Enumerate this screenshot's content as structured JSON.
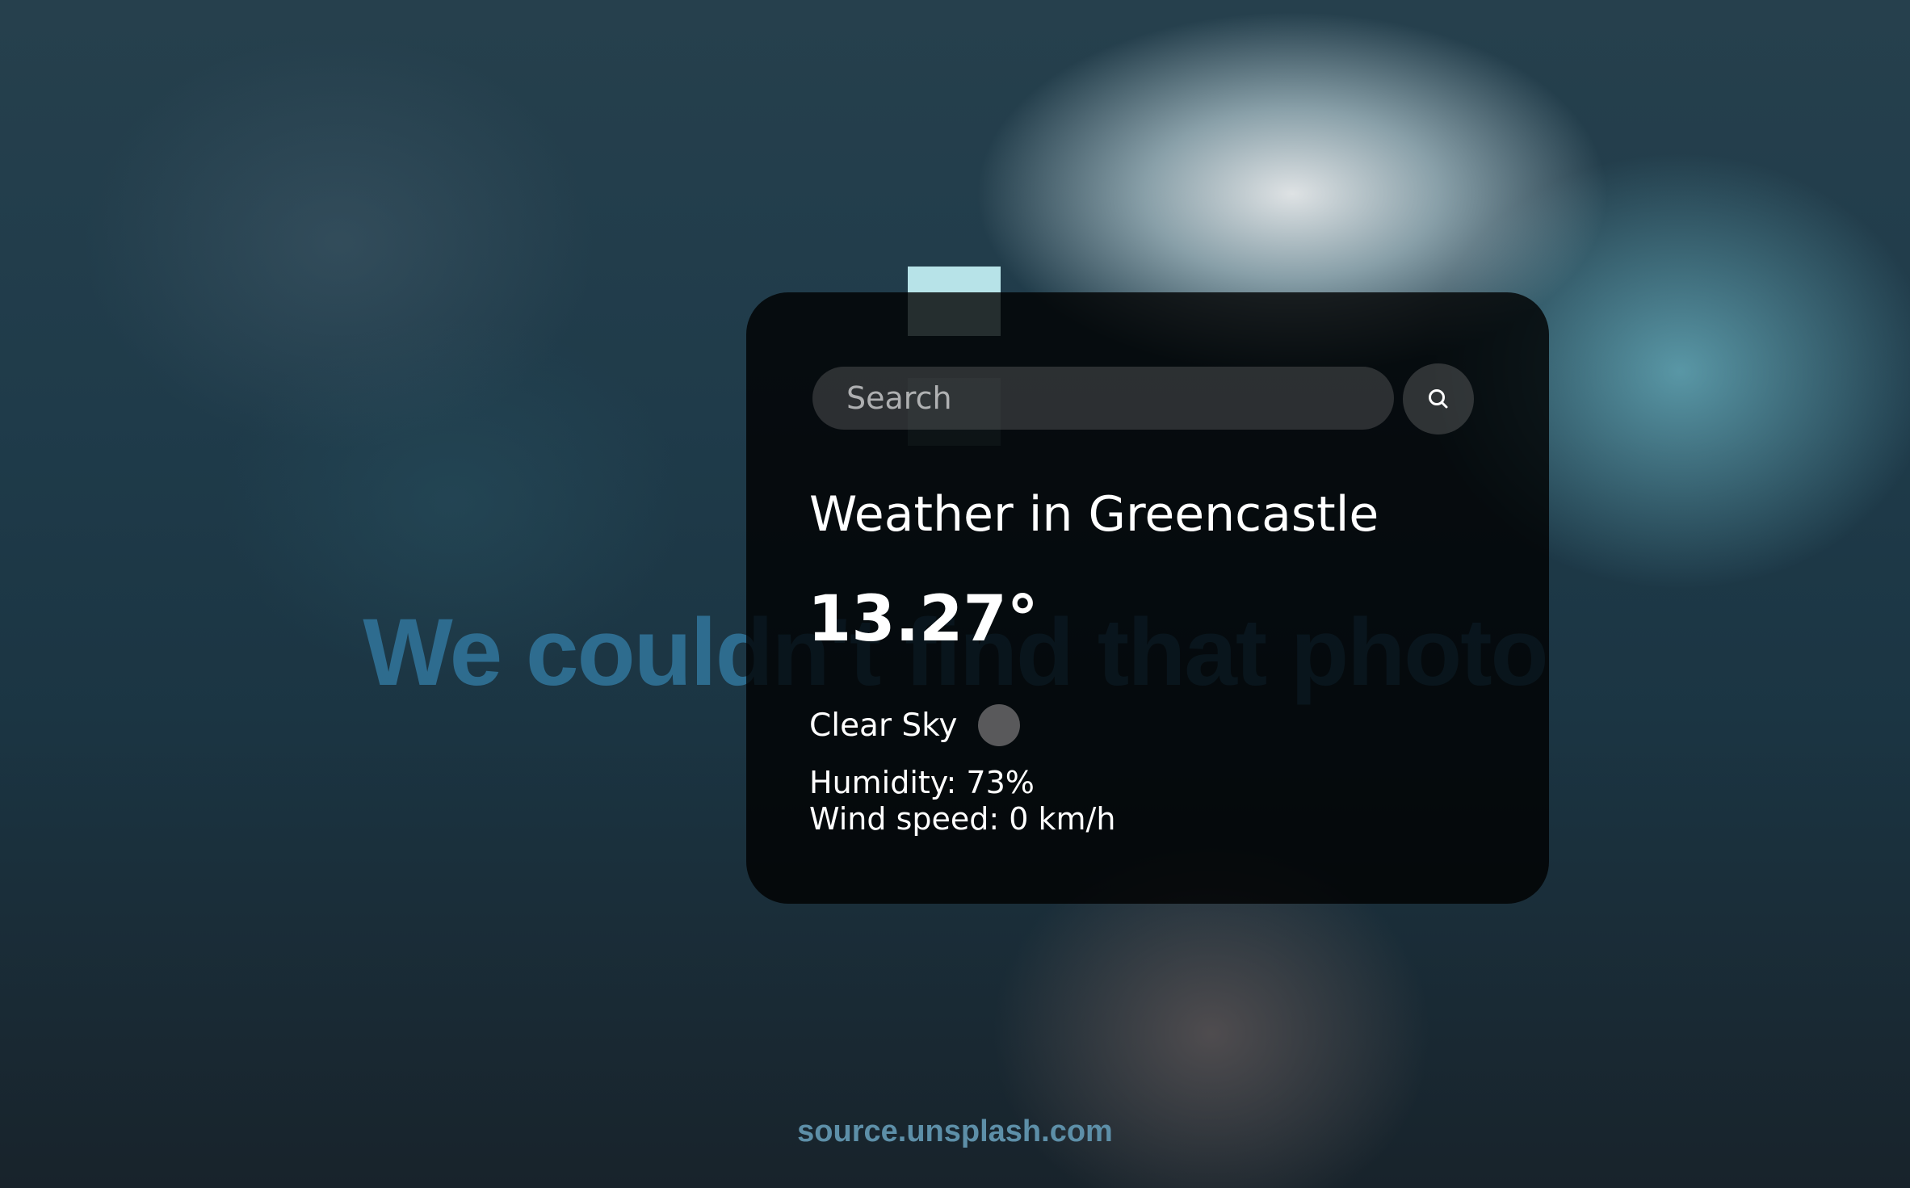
{
  "background": {
    "message": "We couldn't find that photo",
    "source": "source.unsplash.com"
  },
  "search": {
    "placeholder": "Search",
    "button_icon": "search-icon"
  },
  "weather": {
    "title": "Weather in Greencastle",
    "temperature": "13.27°",
    "description": "Clear Sky",
    "condition_icon": "weather-icon",
    "humidity": "Humidity: 73%",
    "wind": "Wind speed: 0 km/h"
  },
  "colors": {
    "card_background": "#000000",
    "text": "#ffffff",
    "background_message": "#2f6f93"
  }
}
